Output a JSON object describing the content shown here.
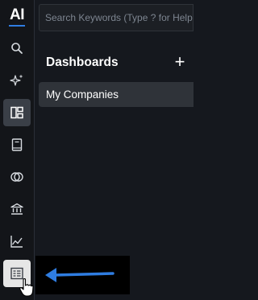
{
  "app": {
    "logo_text": "AI",
    "accent": "#2f7de1"
  },
  "search": {
    "placeholder": "Search Keywords (Type ? for Help)",
    "value": ""
  },
  "sidebar": {
    "items": [
      {
        "icon": "search-icon",
        "state": "default"
      },
      {
        "icon": "sparkle-icon",
        "state": "default"
      },
      {
        "icon": "dashboard-icon",
        "state": "active"
      },
      {
        "icon": "notebook-icon",
        "state": "default"
      },
      {
        "icon": "overlap-circles-icon",
        "state": "default"
      },
      {
        "icon": "bank-icon",
        "state": "default"
      },
      {
        "icon": "line-chart-icon",
        "state": "default"
      },
      {
        "icon": "table-list-icon",
        "state": "hovered"
      }
    ]
  },
  "panel": {
    "title": "Dashboards",
    "add_label": "+"
  },
  "list": [
    {
      "label": "My Companies"
    }
  ],
  "annotation": {
    "icon": "arrow-left-icon",
    "color": "#2f7de1"
  }
}
